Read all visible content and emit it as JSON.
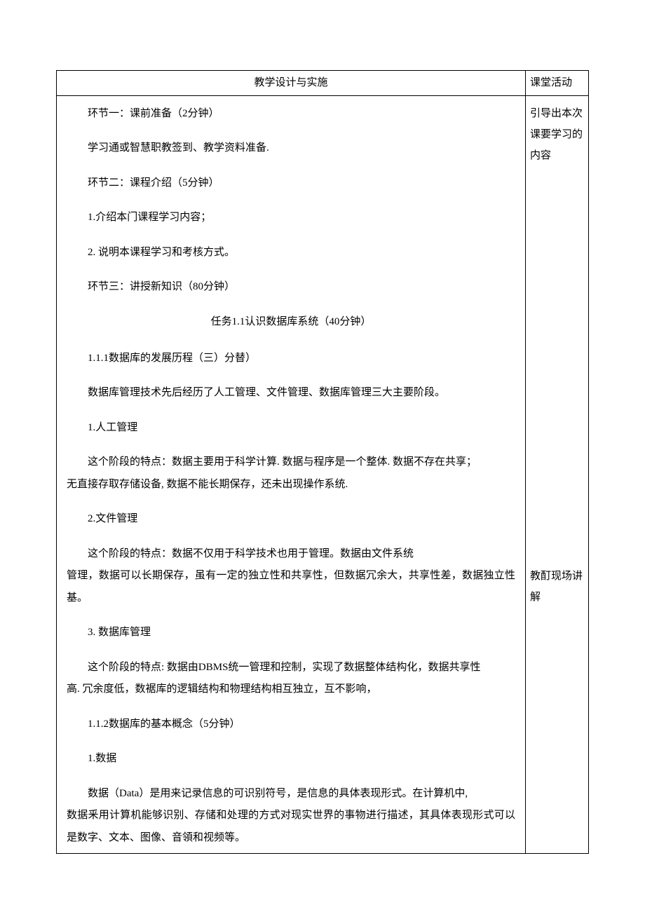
{
  "header": {
    "left": "教学设计与实施",
    "right": "课堂活动"
  },
  "side": {
    "note1": "引导出本次课要学习的内容",
    "note2": "教酊现场讲解"
  },
  "body": {
    "p01": "环节一：课前准备（2分钟）",
    "p02": "学习通或智慧职教签到、教学资料准备.",
    "p03": "环节二：课程介绍（5分钟）",
    "p04": "1.介绍本门课程学习内容；",
    "p05": "2. 说明本课程学习和考核方式。",
    "p06": "环节三：讲授新知识（80分钟）",
    "task": "任务1.1认识数据库系统（40分钟）",
    "p07": "1.1.1数据库的发展历程（三）分替）",
    "p08": "数据库管理技术先后经历了人工管理、文件管理、数据库管理三大主要阶段。",
    "p09": "1.人工管理",
    "p10a": "这个阶段的特点：数据主要用于科学计算. 数据与程序是一个整体. 数据不存在共享；",
    "p10b": "无直接存取存储设备, 数据不能长期保存，还未出现操作系统.",
    "p11": "2.文件管理",
    "p12a": "这个阶段的特点：数据不仅用于科学技术也用于管理。数据由文件系统",
    "p12b": "管理，数据可以长期保存，虽有一定的独立性和共享性，但数据冗余大，共享性差，数据独立性基。",
    "p13": "3. 数据库管理",
    "p14a": "这个阶段的特点: 数据由DBMS统一管理和控制，实现了数据整体结构化，数据共享性",
    "p14b": "高. 冗余度低，数裾库的逻辑结构和物理结构相互独立，互不影响，",
    "p15": "1.1.2数据库的基本概念（5分钟）",
    "p16": "1.数据",
    "p17a": "数据（Data）是用来记录信息的可识别符号，是信息的具体表现形式。在计算机中,",
    "p17b": "数据釆用计算机能够识别、存储和处理的方式对现实世界的事物进行描述，其具体表现形式可以是数字、文本、图像、音領和视频等。"
  }
}
